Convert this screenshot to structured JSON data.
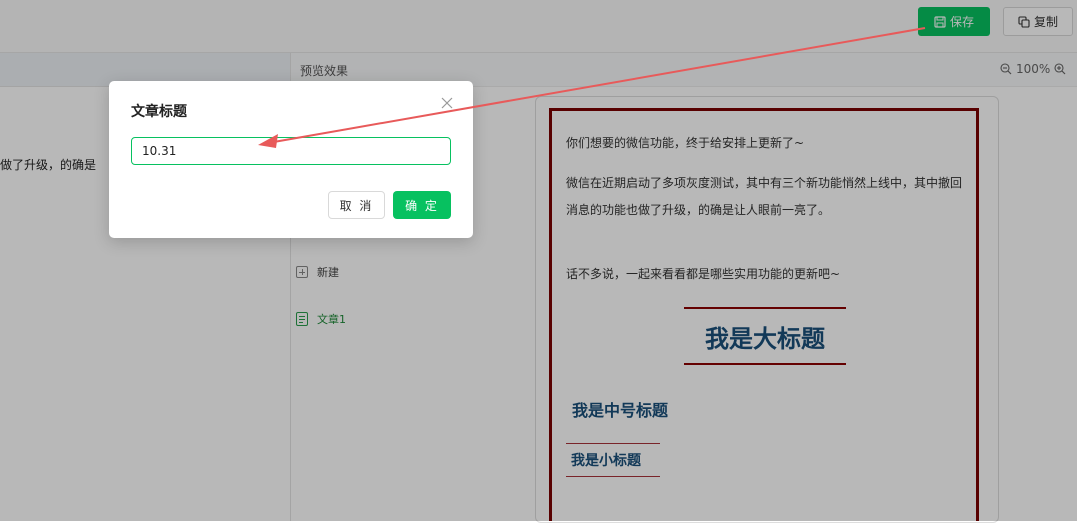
{
  "toolbar": {
    "save_label": "保存",
    "copy_label": "复制"
  },
  "editor": {
    "visible_text": "做了升级，的确是"
  },
  "preview": {
    "header_title": "预览效果",
    "zoom_level": "100%",
    "paragraph1": "你们想要的微信功能，终于给安排上更新了~",
    "paragraph2": "微信在近期启动了多项灰度测试，其中有三个新功能悄然上线中，其中撤回消息的功能也做了升级，的确是让人眼前一亮了。",
    "paragraph3": "话不多说，一起来看看都是哪些实用功能的更新吧~",
    "big_title": "我是大标题",
    "mid_title": "我是中号标题",
    "small_title": "我是小标题"
  },
  "article_list": {
    "new_label": "新建",
    "article_label": "文章1"
  },
  "dialog": {
    "title": "文章标题",
    "input_value": "10.31",
    "cancel_label": "取 消",
    "confirm_label": "确 定"
  },
  "colors": {
    "accent": "#07c160",
    "annotation_arrow": "#e85a5a",
    "article_border": "#7a0000",
    "heading_text": "#1a4f7a"
  }
}
